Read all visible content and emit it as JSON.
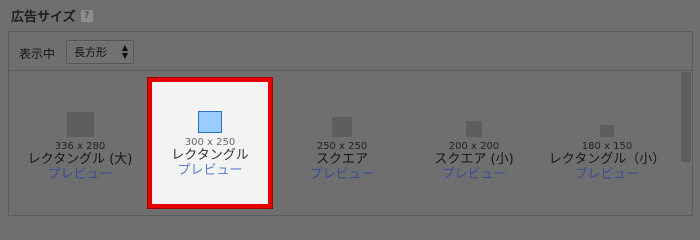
{
  "section": {
    "title": "広告サイズ",
    "help_icon": "?"
  },
  "filter": {
    "label": "表示中",
    "selected": "長方形",
    "arrows": "▲▼"
  },
  "ad_sizes": [
    {
      "dimensions": "336 x 280",
      "name": "レクタングル (大)",
      "preview": "プレビュー"
    },
    {
      "dimensions": "300 x 250",
      "name": "レクタングル",
      "preview": "プレビュー"
    },
    {
      "dimensions": "250 x 250",
      "name": "スクエア",
      "preview": "プレビュー"
    },
    {
      "dimensions": "200 x 200",
      "name": "スクエア (小)",
      "preview": "プレビュー"
    },
    {
      "dimensions": "180 x 150",
      "name": "レクタングル（小）",
      "preview": "プレビュー"
    }
  ],
  "colors": {
    "highlight_border": "#e60000",
    "selected_thumb": "#99ccff",
    "link": "#5b7fd6"
  }
}
